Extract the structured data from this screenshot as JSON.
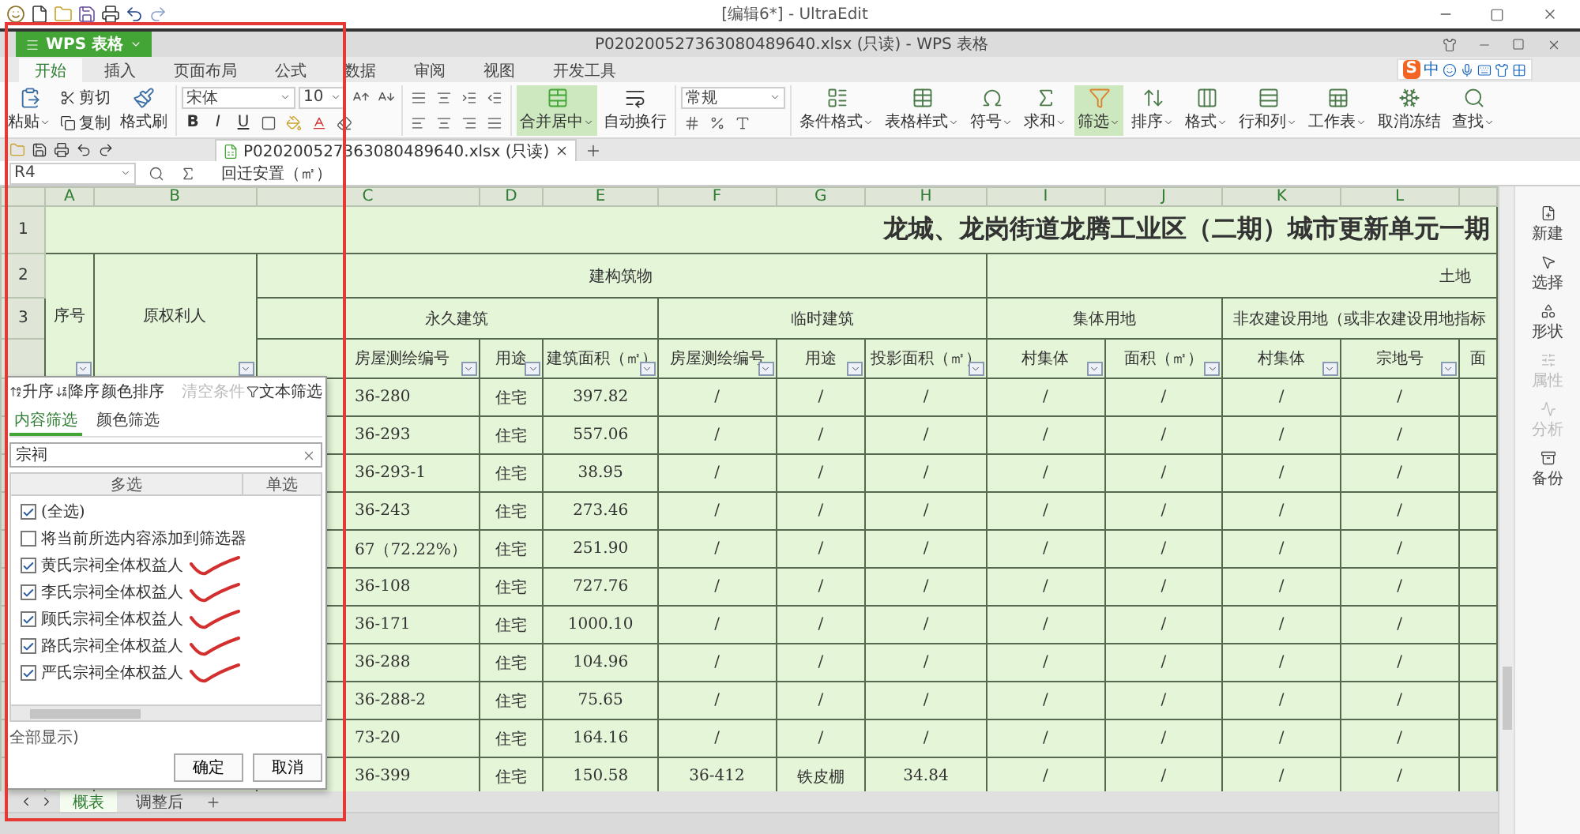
{
  "title_bar": {
    "title": "[编辑6*] - UltraEdit"
  },
  "window": {
    "app_button": "WPS 表格",
    "title": "P020200527363080489640.xlsx (只读) - WPS 表格"
  },
  "menu_tabs": [
    {
      "label": "开始",
      "selected": true
    },
    {
      "label": "插入",
      "selected": false
    },
    {
      "label": "页面布局",
      "selected": false
    },
    {
      "label": "公式",
      "selected": false
    },
    {
      "label": "数据",
      "selected": false
    },
    {
      "label": "审阅",
      "selected": false
    },
    {
      "label": "视图",
      "selected": false
    },
    {
      "label": "开发工具",
      "selected": false
    }
  ],
  "ime": {
    "logo": "S",
    "mode": "中"
  },
  "ribbon": {
    "paste": "粘贴",
    "cut": "剪切",
    "copy": "复制",
    "format_painter": "格式刷",
    "font": "宋体",
    "size": "10",
    "styles": [
      "B",
      "I",
      "U"
    ],
    "merge": "合并居中",
    "wrap": "自动换行",
    "number_format": "常规",
    "tools": [
      {
        "label": "条件格式",
        "menu": true,
        "selected": false
      },
      {
        "label": "表格样式",
        "menu": true,
        "selected": false
      },
      {
        "label": "符号",
        "menu": true,
        "selected": false
      },
      {
        "label": "求和",
        "menu": true,
        "selected": false
      },
      {
        "label": "筛选",
        "menu": true,
        "selected": true
      },
      {
        "label": "排序",
        "menu": true,
        "selected": false
      },
      {
        "label": "格式",
        "menu": true,
        "selected": false
      },
      {
        "label": "行和列",
        "menu": true,
        "selected": false
      },
      {
        "label": "工作表",
        "menu": true,
        "selected": false
      },
      {
        "label": "取消冻结",
        "menu": false,
        "selected": false
      },
      {
        "label": "查找",
        "menu": true,
        "selected": false
      }
    ]
  },
  "doc_tab": {
    "label": "P020200527363080489640.xlsx (只读)"
  },
  "formula_bar": {
    "cell": "R4",
    "formula": "回迁安置（㎡）"
  },
  "sheet": {
    "columns": [
      "A",
      "B",
      "C",
      "D",
      "E",
      "F",
      "G",
      "H",
      "I",
      "J",
      "K",
      "L"
    ],
    "row_numbers": [
      "1",
      "2",
      "3"
    ],
    "title": "龙城、龙岗街道龙腾工业区（二期）城市更新单元一期",
    "index_header": "序号",
    "owner_header": "原权利人",
    "groups": [
      "建构筑物",
      "土地"
    ],
    "subgroups": [
      "永久建筑",
      "临时建筑",
      "集体用地",
      "非农建设用地（或非农建设用地指标"
    ],
    "fields": [
      "房屋测绘编号",
      "用途",
      "建筑面积（㎡）",
      "房屋测绘编号",
      "用途",
      "投影面积（㎡）",
      "村集体",
      "面积（㎡）",
      "村集体",
      "宗地号",
      "面"
    ],
    "rows": [
      [
        "",
        "",
        "36-280",
        "住宅",
        "397.82",
        "/",
        "/",
        "/",
        "/",
        "/",
        "/",
        "/"
      ],
      [
        "",
        "",
        "36-293",
        "住宅",
        "557.06",
        "/",
        "/",
        "/",
        "/",
        "/",
        "/",
        "/"
      ],
      [
        "",
        "",
        "36-293-1",
        "住宅",
        "38.95",
        "/",
        "/",
        "/",
        "/",
        "/",
        "/",
        "/"
      ],
      [
        "",
        "",
        "36-243",
        "住宅",
        "273.46",
        "/",
        "/",
        "/",
        "/",
        "/",
        "/",
        "/"
      ],
      [
        "",
        "",
        "67（72.22%）",
        "住宅",
        "251.90",
        "/",
        "/",
        "/",
        "/",
        "/",
        "/",
        "/"
      ],
      [
        "",
        "",
        "36-108",
        "住宅",
        "727.76",
        "/",
        "/",
        "/",
        "/",
        "/",
        "/",
        "/"
      ],
      [
        "",
        "",
        "36-171",
        "住宅",
        "1000.10",
        "/",
        "/",
        "/",
        "/",
        "/",
        "/",
        "/"
      ],
      [
        "",
        "",
        "36-288",
        "住宅",
        "104.96",
        "/",
        "/",
        "/",
        "/",
        "/",
        "/",
        "/"
      ],
      [
        "",
        "",
        "36-288-2",
        "住宅",
        "75.65",
        "/",
        "/",
        "/",
        "/",
        "/",
        "/",
        "/"
      ],
      [
        "",
        "",
        "73-20",
        "住宅",
        "164.16",
        "/",
        "/",
        "/",
        "/",
        "/",
        "/",
        "/"
      ],
      [
        "",
        "",
        "36-399",
        "住宅",
        "150.58",
        "36-412",
        "铁皮棚",
        "34.84",
        "/",
        "/",
        "/",
        "/"
      ]
    ]
  },
  "filter": {
    "sort": [
      "升序",
      "降序",
      "颜色排序"
    ],
    "clear": {
      "label": "清空条件",
      "disabled": true
    },
    "text_filter": "文本筛选",
    "tabs": [
      {
        "label": "内容筛选",
        "selected": true
      },
      {
        "label": "颜色筛选",
        "selected": false
      }
    ],
    "search": {
      "value": "宗祠"
    },
    "columns": [
      "多选",
      "单选"
    ],
    "items": [
      {
        "label": "(全选)",
        "checked": true,
        "marked": false
      },
      {
        "label": "将当前所选内容添加到筛选器",
        "checked": false,
        "marked": false
      },
      {
        "label": "黄氏宗祠全体权益人",
        "checked": true,
        "marked": true
      },
      {
        "label": "李氏宗祠全体权益人",
        "checked": true,
        "marked": true
      },
      {
        "label": "顾氏宗祠全体权益人",
        "checked": true,
        "marked": true
      },
      {
        "label": "路氏宗祠全体权益人",
        "checked": true,
        "marked": true
      },
      {
        "label": "严氏宗祠全体权益人",
        "checked": true,
        "marked": true
      }
    ],
    "show_all": "全部显示)",
    "buttons": [
      "确定",
      "取消"
    ]
  },
  "sheet_tabs": [
    {
      "label": "概表",
      "selected": true
    },
    {
      "label": "调整后",
      "selected": false
    }
  ],
  "sidebar": [
    {
      "label": "新建",
      "disabled": false
    },
    {
      "label": "选择",
      "disabled": false
    },
    {
      "label": "形状",
      "disabled": false
    },
    {
      "label": "属性",
      "disabled": true
    },
    {
      "label": "分析",
      "disabled": true
    },
    {
      "label": "备份",
      "disabled": false
    }
  ]
}
